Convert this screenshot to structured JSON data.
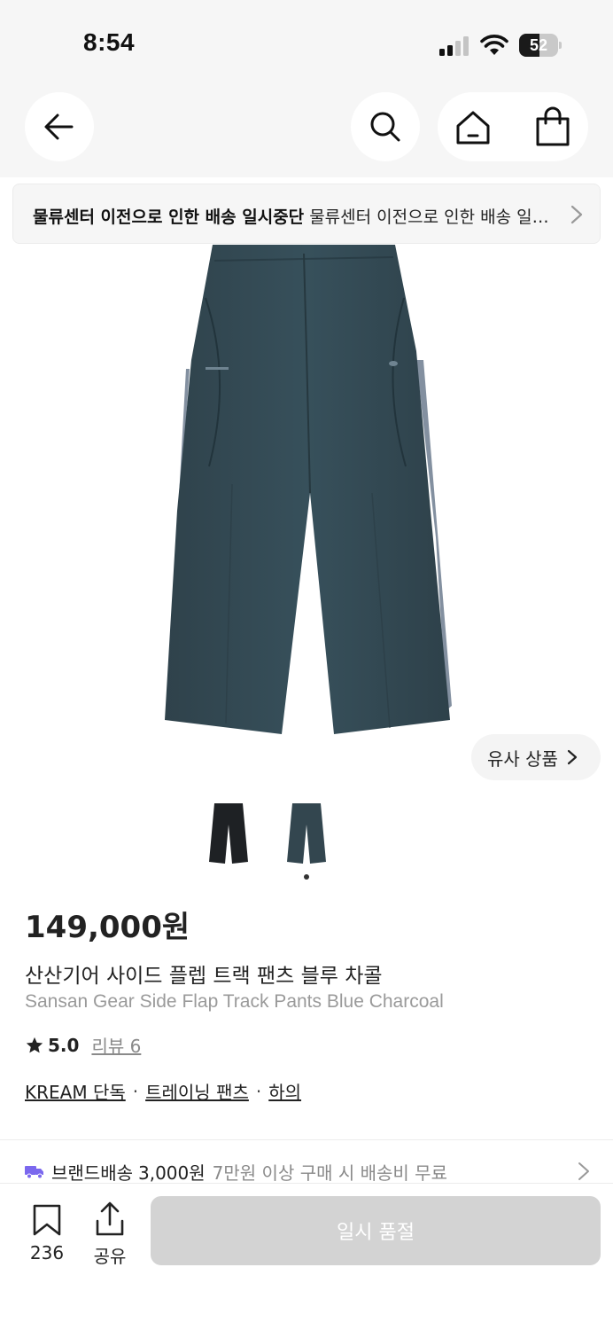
{
  "status_bar": {
    "time": "8:54",
    "battery_level": "52"
  },
  "header": {
    "icons": [
      "back-arrow-icon",
      "search-icon",
      "home-icon",
      "shopping-bag-icon"
    ]
  },
  "notice": {
    "title": "물류센터 이전으로 인한 배송 일시중단",
    "body": "물류센터 이전으로 인한 배송 일시중단"
  },
  "product": {
    "similar_button": "유사 상품",
    "image_count": 2,
    "selected_image_index": 2,
    "price": "149,000원",
    "name_ko": "산산기어 사이드 플렙 트랙 팬츠 블루 차콜",
    "name_en": "Sansan Gear Side Flap Track Pants Blue Charcoal",
    "rating": "5.0",
    "review_label": "리뷰 6",
    "categories": [
      "KREAM 단독",
      "트레이닝 팬츠",
      "하의"
    ],
    "category_separator": "·"
  },
  "shipping": {
    "label": "브랜드배송",
    "fee": "3,000원",
    "note": "7만원 이상 구매 시 배송비 무료"
  },
  "bottom_bar": {
    "bookmark_count": "236",
    "share_label": "공유",
    "soldout_label": "일시 품절"
  },
  "colors": {
    "accent_truck": "#7b68ee",
    "pants_color": "#33464f",
    "black_pants": "#1e2124",
    "soldout_button": "#d3d3d3"
  }
}
